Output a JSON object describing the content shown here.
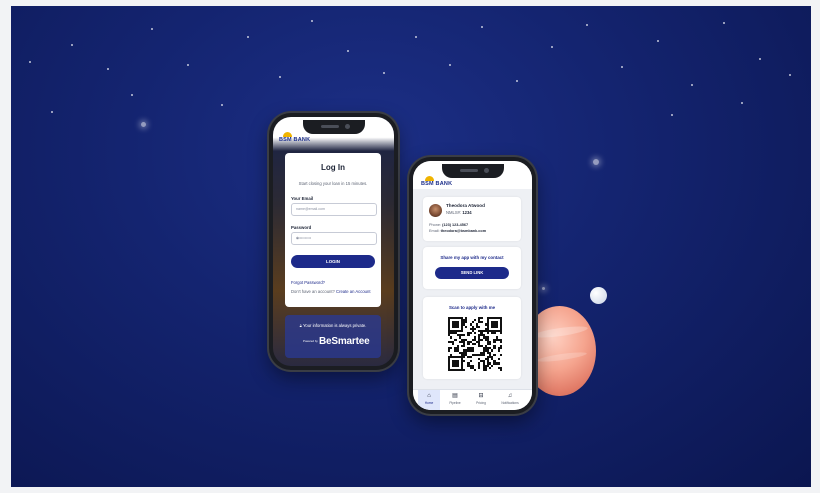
{
  "login_screen": {
    "bank_name": "BSM BANK",
    "title": "Log In",
    "subtitle": "Start closing your loan in 15 minutes.",
    "email_label": "Your Email",
    "email_placeholder": "name@email.com",
    "password_label": "Password",
    "password_value": "••••••••••••",
    "login_button": "LOGIN",
    "forgot_password": "Forgot Password?",
    "no_account_text": "Don't have an account?",
    "create_account_link": "Create an Account",
    "privacy_text": "Your information is always private.",
    "powered_by": "Powered by",
    "brand": "BeSmartee"
  },
  "loan_officer_screen": {
    "bank_name": "BSM BANK",
    "officer_name": "Theodora Atwood",
    "nmls_label": "NMLS#:",
    "nmls_value": "1234",
    "phone_label": "Phone:",
    "phone_value": "(123) 123-4567",
    "email_label": "Email:",
    "email_value": "theodora@bsmbank.com",
    "share_title": "Share my app with my contact",
    "send_link_button": "SEND LINK",
    "scan_title": "Scan to apply with me",
    "tabs": [
      {
        "label": "Home",
        "icon": "home-icon",
        "glyph": "⌂"
      },
      {
        "label": "Pipeline",
        "icon": "document-icon",
        "glyph": "▤"
      },
      {
        "label": "Pricing",
        "icon": "calculator-icon",
        "glyph": "⊟"
      },
      {
        "label": "Notifications",
        "icon": "bell-icon",
        "glyph": "♫"
      }
    ]
  },
  "colors": {
    "background": "#142470",
    "brand_navy": "#1d2a8a",
    "brand_gold": "#f0b400"
  }
}
